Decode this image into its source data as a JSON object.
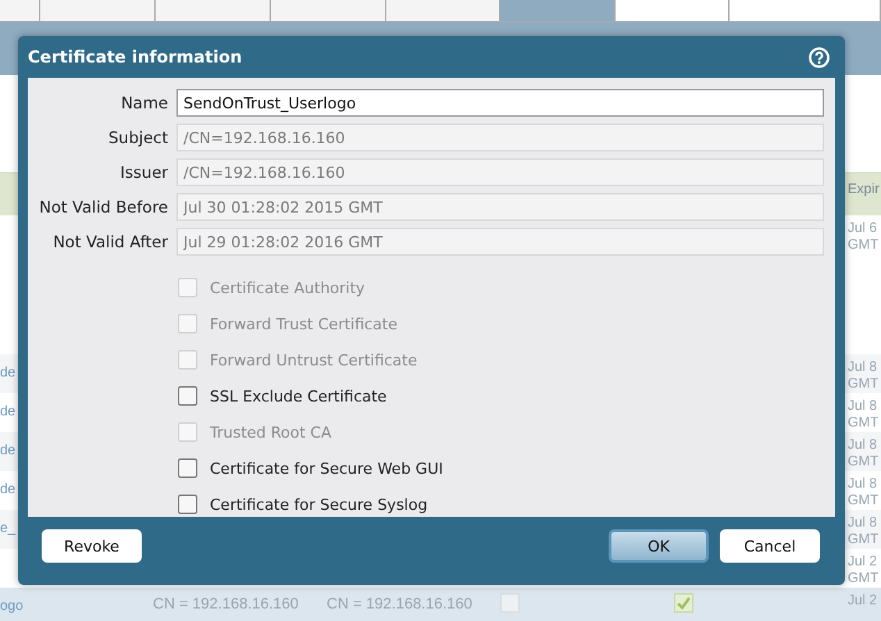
{
  "background": {
    "column_header": "Expir",
    "rows": [
      {
        "name": "",
        "date": [
          "Jul 6",
          "GMT"
        ],
        "cn1": "",
        "cn2": "",
        "check1": null,
        "check2": null
      },
      {
        "name": "de",
        "date": [
          "Jul 8",
          "GMT"
        ],
        "cn1": "",
        "cn2": "",
        "check1": null,
        "check2": null
      },
      {
        "name": "de",
        "date": [
          "Jul 8",
          "GMT"
        ],
        "cn1": "",
        "cn2": "",
        "check1": null,
        "check2": null
      },
      {
        "name": "de",
        "date": [
          "Jul 8",
          "GMT"
        ],
        "cn1": "",
        "cn2": "",
        "check1": null,
        "check2": null
      },
      {
        "name": "de",
        "date": [
          "Jul 8",
          "GMT"
        ],
        "cn1": "",
        "cn2": "",
        "check1": null,
        "check2": null
      },
      {
        "name": "e_",
        "date": [
          "Jul 8",
          "GMT"
        ],
        "cn1": "",
        "cn2": "",
        "check1": null,
        "check2": null
      },
      {
        "name": "",
        "date": [
          "Jul 2",
          "GMT"
        ],
        "cn1": "",
        "cn2": "",
        "check1": null,
        "check2": null
      },
      {
        "name": "ogo",
        "date": [
          "Jul 2"
        ],
        "cn1": "CN = 192.168.16.160",
        "cn2": "CN = 192.168.16.160",
        "check1": false,
        "check2": true
      }
    ]
  },
  "dialog": {
    "title": "Certificate information",
    "fields": [
      {
        "label": "Name",
        "value": "SendOnTrust_Userlogo",
        "disabled": false
      },
      {
        "label": "Subject",
        "value": "/CN=192.168.16.160",
        "disabled": true
      },
      {
        "label": "Issuer",
        "value": "/CN=192.168.16.160",
        "disabled": true
      },
      {
        "label": "Not Valid Before",
        "value": "Jul 30 01:28:02 2015 GMT",
        "disabled": true
      },
      {
        "label": "Not Valid After",
        "value": "Jul 29 01:28:02 2016 GMT",
        "disabled": true
      }
    ],
    "checkboxes": [
      {
        "label": "Certificate Authority",
        "checked": false,
        "disabled": true
      },
      {
        "label": "Forward Trust Certificate",
        "checked": false,
        "disabled": true
      },
      {
        "label": "Forward Untrust Certificate",
        "checked": false,
        "disabled": true
      },
      {
        "label": "SSL Exclude Certificate",
        "checked": false,
        "disabled": false
      },
      {
        "label": "Trusted Root CA",
        "checked": false,
        "disabled": true
      },
      {
        "label": "Certificate for Secure Web GUI",
        "checked": false,
        "disabled": false
      },
      {
        "label": "Certificate for Secure Syslog",
        "checked": false,
        "disabled": false
      }
    ],
    "left_buttons": [
      {
        "label": "Revoke",
        "primary": false
      }
    ],
    "right_buttons": [
      {
        "label": "OK",
        "primary": true
      },
      {
        "label": "Cancel",
        "primary": false
      }
    ]
  }
}
